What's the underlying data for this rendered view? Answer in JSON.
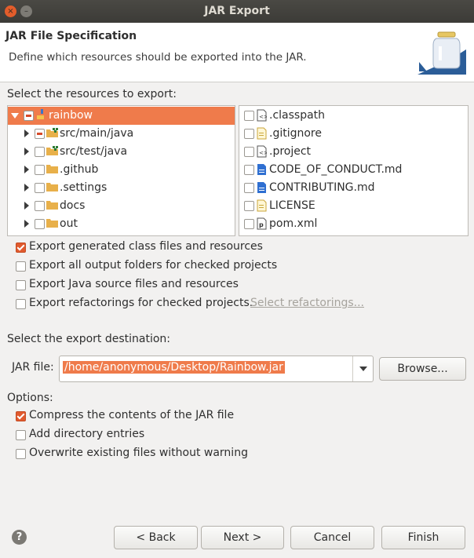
{
  "window": {
    "title": "JAR Export",
    "close_glyph": "×",
    "min_glyph": "–"
  },
  "header": {
    "title": "JAR File Specification",
    "description": "Define which resources should be exported into the JAR."
  },
  "resources": {
    "label": "Select the resources to export:",
    "tree": [
      {
        "label": "rainbow"
      },
      {
        "label": "src/main/java"
      },
      {
        "label": "src/test/java"
      },
      {
        "label": ".github"
      },
      {
        "label": ".settings"
      },
      {
        "label": "docs"
      },
      {
        "label": "out"
      }
    ],
    "files": [
      {
        "label": ".classpath"
      },
      {
        "label": ".gitignore"
      },
      {
        "label": ".project"
      },
      {
        "label": "CODE_OF_CONDUCT.md"
      },
      {
        "label": "CONTRIBUTING.md"
      },
      {
        "label": "LICENSE"
      },
      {
        "label": "pom.xml"
      }
    ]
  },
  "export_options": {
    "generated_class": "Export generated class files and resources",
    "output_folders": "Export all output folders for checked projects",
    "java_source": "Export Java source files and resources",
    "refactorings": "Export refactorings for checked projects.",
    "select_refactorings": "Select refactorings..."
  },
  "destination": {
    "label": "Select the export destination:",
    "jar_label": "JAR file:",
    "jar_value": "/home/anonymous/Desktop/Rainbow.jar",
    "browse": "Browse..."
  },
  "options": {
    "label": "Options:",
    "compress": "Compress the contents of the JAR file",
    "add_dirs": "Add directory entries",
    "overwrite": "Overwrite existing files without warning"
  },
  "buttons": {
    "help": "?",
    "back": "< Back",
    "next": "Next >",
    "cancel": "Cancel",
    "finish": "Finish"
  },
  "colors": {
    "accent": "#ef7b4b",
    "header_bg": "#ffffff",
    "dialog_bg": "#f2f1f0"
  }
}
